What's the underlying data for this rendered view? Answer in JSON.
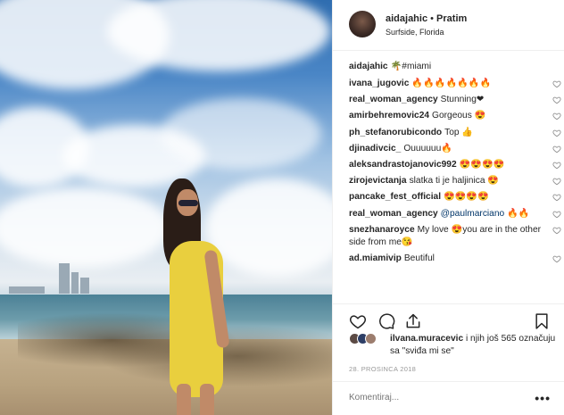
{
  "header": {
    "username": "aidajahic",
    "separator": " • ",
    "follow_label": "Pratim",
    "location": "Surfside, Florida"
  },
  "caption": {
    "username": "aidajahic",
    "text": "🌴#miami"
  },
  "comments": [
    {
      "user": "ivana_jugovic",
      "text": "🔥🔥🔥🔥🔥🔥🔥",
      "mention": ""
    },
    {
      "user": "real_woman_agency",
      "text": "Stunning❤",
      "mention": ""
    },
    {
      "user": "amirbehremovic24",
      "text": "Gorgeous 😍",
      "mention": ""
    },
    {
      "user": "ph_stefanorubicondo",
      "text": "Top 👍",
      "mention": ""
    },
    {
      "user": "djinadivcic_",
      "text": "Ouuuuuu🔥",
      "mention": ""
    },
    {
      "user": "aleksandrastojanovic992",
      "text": "😍😍😍😍",
      "mention": ""
    },
    {
      "user": "zirojevictanja",
      "text": "slatka ti je haljinica 😍",
      "mention": ""
    },
    {
      "user": "pancake_fest_official",
      "text": "😍😍😍😍",
      "mention": ""
    },
    {
      "user": "real_woman_agency",
      "text": "🔥🔥",
      "mention": "@paulmarciano"
    },
    {
      "user": "snezhanaroyce",
      "text": "My love 😍you are in the other side from me😘",
      "mention": ""
    },
    {
      "user": "ad.miamivip",
      "text": "Beutiful",
      "mention": ""
    }
  ],
  "likes": {
    "user": "ilvana.muracevic",
    "text": " i njih još 565 označuju sa \"sviđa mi se\""
  },
  "date": "28. PROSINCA 2018",
  "add_comment": {
    "placeholder": "Komentiraj..."
  },
  "icons": [
    "heart-icon",
    "comment-icon",
    "share-icon",
    "bookmark-icon",
    "more-options-icon"
  ],
  "colors": {
    "text": "#262626",
    "mention": "#003569",
    "muted": "#999999",
    "border": "#efefef"
  }
}
